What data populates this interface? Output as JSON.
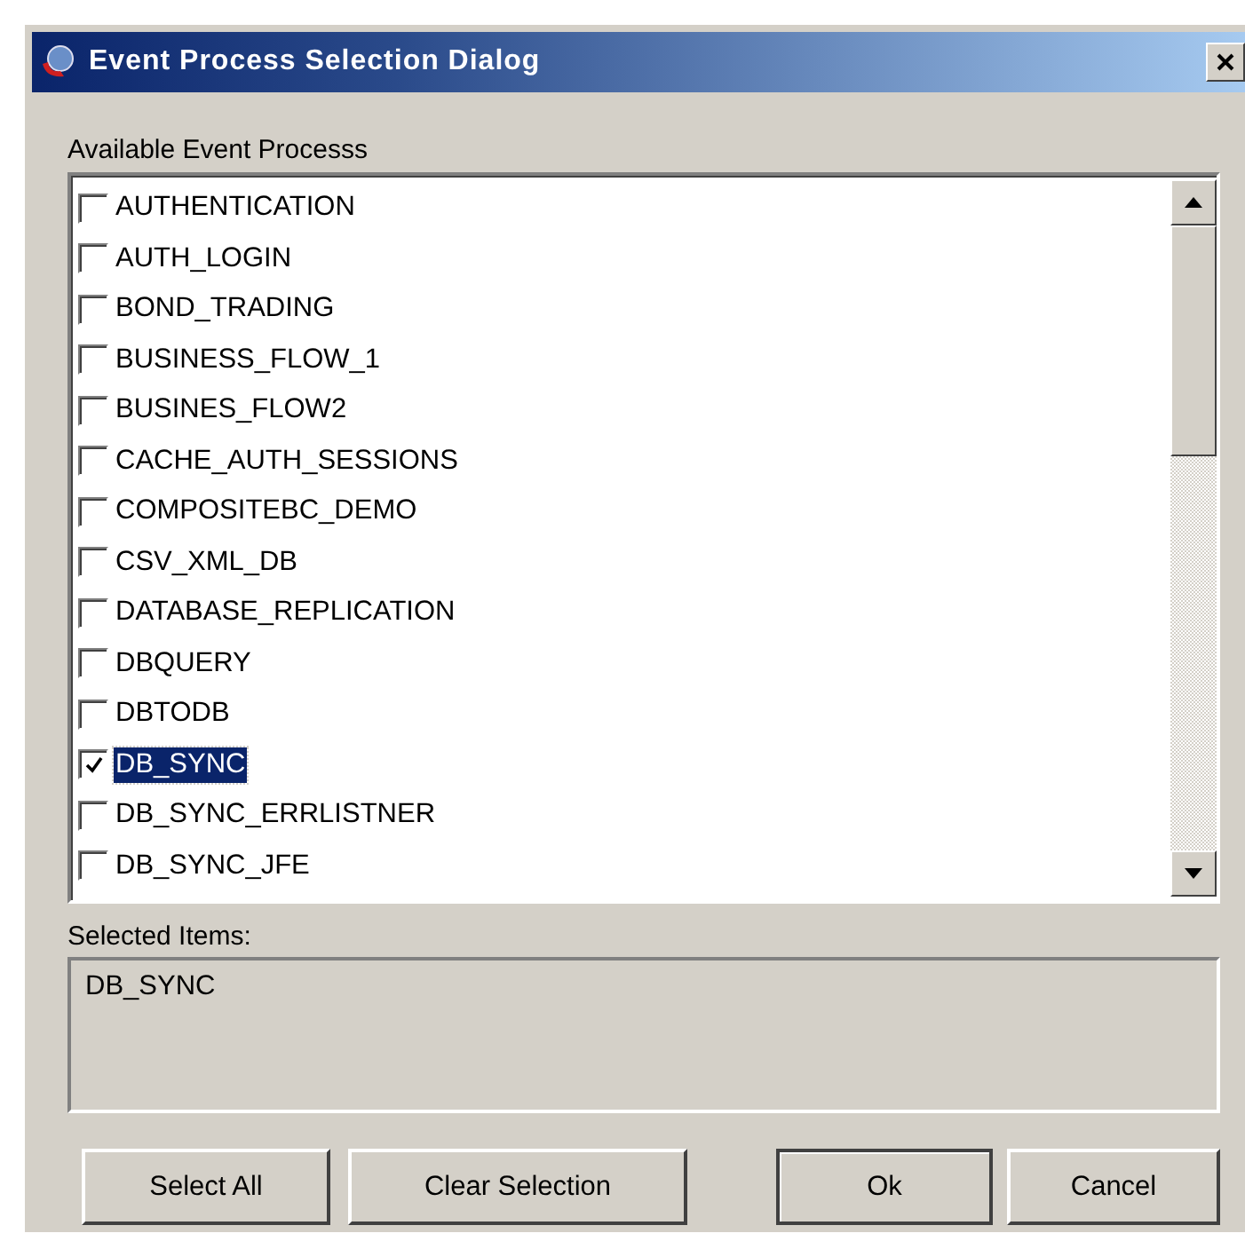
{
  "window": {
    "title": "Event Process Selection Dialog"
  },
  "available": {
    "label": "Available Event Processs",
    "items": [
      {
        "label": "AUTHENTICATION",
        "checked": false,
        "selected": false
      },
      {
        "label": "AUTH_LOGIN",
        "checked": false,
        "selected": false
      },
      {
        "label": "BOND_TRADING",
        "checked": false,
        "selected": false
      },
      {
        "label": "BUSINESS_FLOW_1",
        "checked": false,
        "selected": false
      },
      {
        "label": "BUSINES_FLOW2",
        "checked": false,
        "selected": false
      },
      {
        "label": "CACHE_AUTH_SESSIONS",
        "checked": false,
        "selected": false
      },
      {
        "label": "COMPOSITEBC_DEMO",
        "checked": false,
        "selected": false
      },
      {
        "label": "CSV_XML_DB",
        "checked": false,
        "selected": false
      },
      {
        "label": "DATABASE_REPLICATION",
        "checked": false,
        "selected": false
      },
      {
        "label": "DBQUERY",
        "checked": false,
        "selected": false
      },
      {
        "label": "DBTODB",
        "checked": false,
        "selected": false
      },
      {
        "label": "DB_SYNC",
        "checked": true,
        "selected": true
      },
      {
        "label": "DB_SYNC_ERRLISTNER",
        "checked": false,
        "selected": false
      },
      {
        "label": "DB_SYNC_JFE",
        "checked": false,
        "selected": false
      }
    ]
  },
  "selected_items": {
    "label": "Selected Items:",
    "value": "DB_SYNC"
  },
  "buttons": [
    {
      "label": "Select All",
      "kind": "left"
    },
    {
      "label": "Clear Selection",
      "kind": "left"
    },
    {
      "label": "Ok",
      "kind": "default"
    },
    {
      "label": "Cancel",
      "kind": "right"
    }
  ]
}
